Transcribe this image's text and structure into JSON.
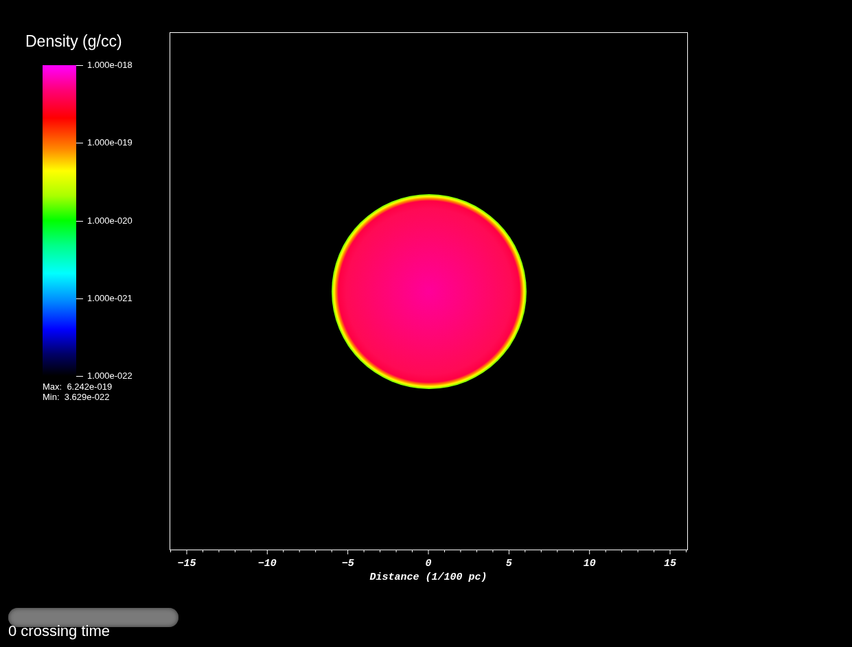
{
  "colorbar": {
    "title": "Density (g/cc)",
    "ticks": [
      "1.000e-018",
      "1.000e-019",
      "1.000e-020",
      "1.000e-021",
      "1.000e-022"
    ],
    "max_label": "Max:  6.242e-019",
    "min_label": "Min:  3.629e-022"
  },
  "plot": {
    "x_axis": {
      "title": "Distance (1/100 pc)",
      "ticks": [
        "−15",
        "−10",
        "−5",
        "0",
        "5",
        "10",
        "15"
      ]
    }
  },
  "time_slider": {
    "label": "0 crossing time"
  }
}
